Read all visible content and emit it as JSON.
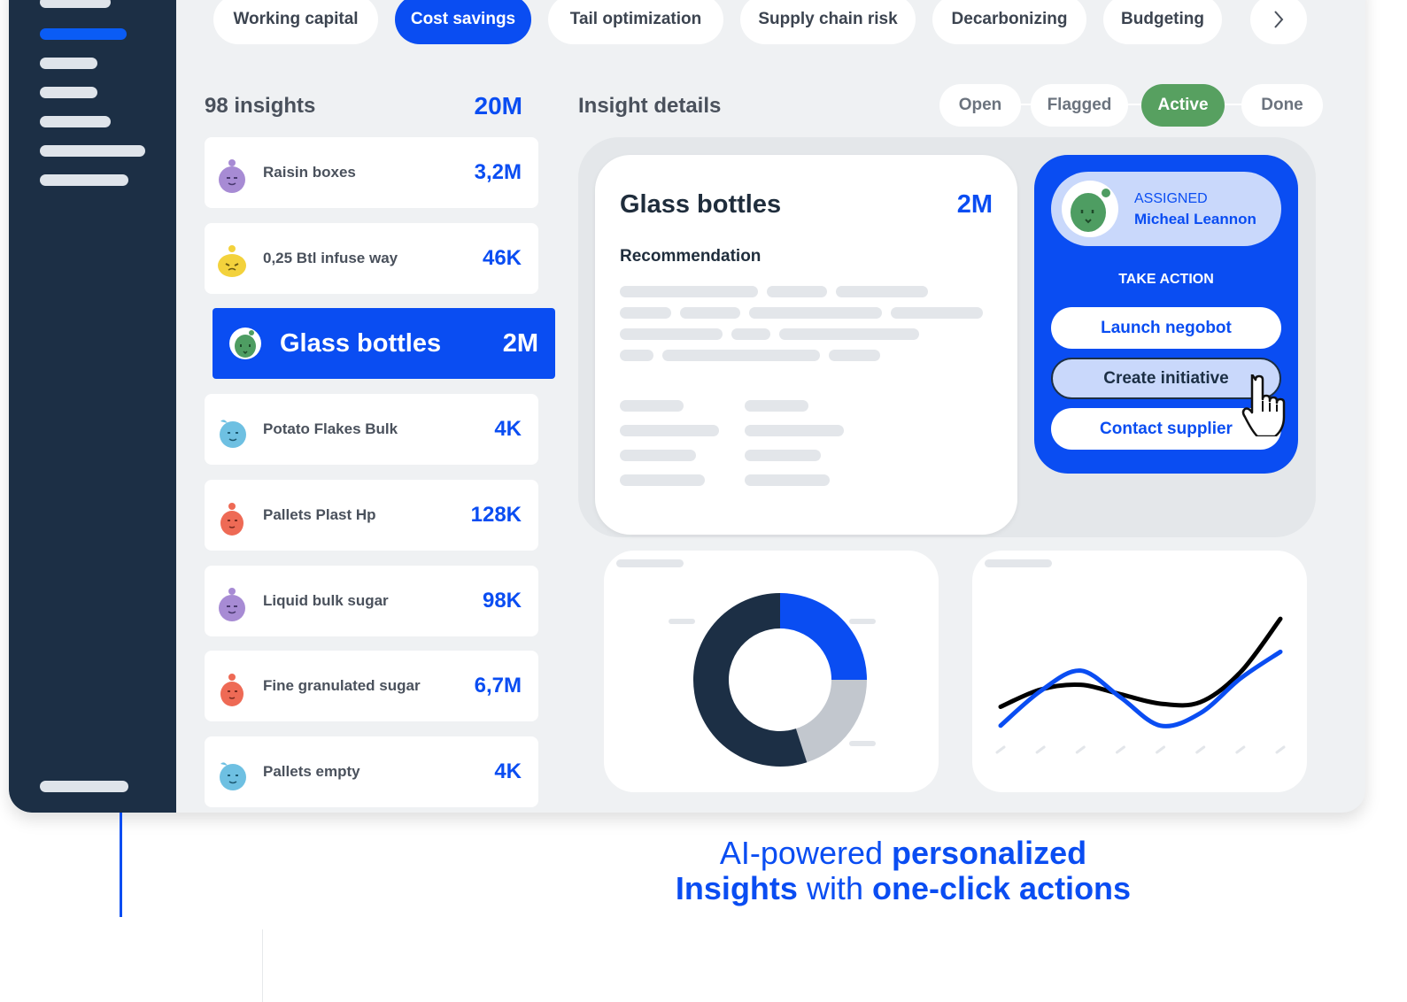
{
  "categories": [
    "Working capital",
    "Cost savings",
    "Tail optimization",
    "Supply chain risk",
    "Decarbonizing",
    "Budgeting"
  ],
  "active_category": "Cost savings",
  "insights": {
    "title": "98 insights",
    "total": "20M",
    "items": [
      {
        "label": "Raisin boxes",
        "value": "3,2M",
        "color": "#a78bd4"
      },
      {
        "label": "0,25 Btl infuse way",
        "value": "46K",
        "color": "#f3d23c"
      },
      {
        "label": "Glass bottles",
        "value": "2M",
        "color": "#4e9d62",
        "selected": true
      },
      {
        "label": "Potato Flakes Bulk",
        "value": "4K",
        "color": "#6ec0e2"
      },
      {
        "label": "Pallets Plast Hp",
        "value": "128K",
        "color": "#ee6a55"
      },
      {
        "label": "Liquid bulk sugar",
        "value": "98K",
        "color": "#a78bd4"
      },
      {
        "label": "Fine granulated sugar",
        "value": "6,7M",
        "color": "#ee6a55"
      },
      {
        "label": "Pallets empty",
        "value": "4K",
        "color": "#6ec0e2"
      }
    ]
  },
  "details": {
    "title": "Insight details",
    "statuses": [
      "Open",
      "Flagged",
      "Active",
      "Done"
    ],
    "active_status": "Active",
    "card": {
      "title": "Glass bottles",
      "value": "2M",
      "subtitle": "Recommendation"
    }
  },
  "action_panel": {
    "assigned_label": "ASSIGNED",
    "assignee": "Micheal Leannon",
    "take_action": "TAKE ACTION",
    "buttons": [
      "Launch negobot",
      "Create initiative",
      "Contact supplier"
    ],
    "hovered": "Create initiative"
  },
  "chart_data": [
    {
      "type": "pie",
      "title": "",
      "slices": [
        {
          "value": 25,
          "color": "#0a4df2"
        },
        {
          "value": 20,
          "color": "#c2c7ce"
        },
        {
          "value": 55,
          "color": "#1c2f45"
        }
      ]
    },
    {
      "type": "line",
      "title": "",
      "x": [
        0,
        1,
        2,
        3,
        4,
        5,
        6,
        7
      ],
      "series": [
        {
          "color": "#000000",
          "values": [
            2,
            3.1,
            3.4,
            2.8,
            2.2,
            2.3,
            4.2,
            7.6
          ]
        },
        {
          "color": "#0a4df2",
          "values": [
            0.8,
            3.0,
            4.3,
            2.6,
            0.8,
            1.6,
            3.8,
            5.5
          ]
        }
      ]
    }
  ],
  "tagline": {
    "line1_light": "AI-powered ",
    "line1_bold": "personalized",
    "line2_bold1": "Insights",
    "line2_light": " with ",
    "line2_bold2": "one-click actions"
  },
  "colors": {
    "accent": "#0a4df2",
    "sidebar": "#1c2f45",
    "active_status": "#57a060"
  }
}
